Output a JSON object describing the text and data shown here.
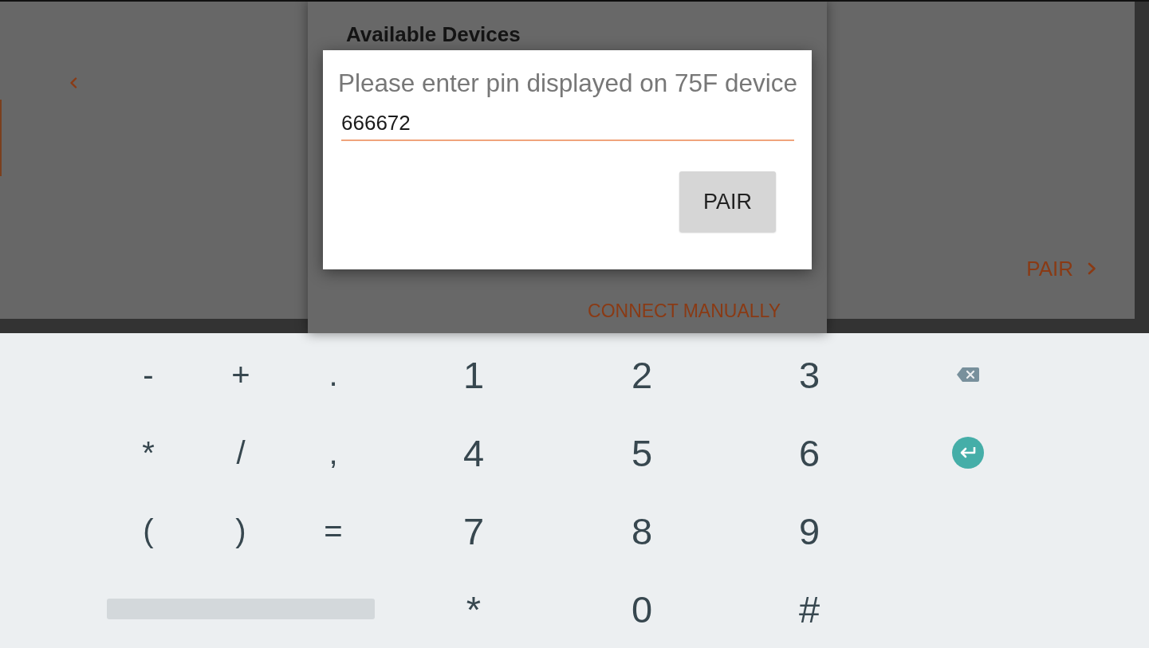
{
  "background": {
    "device_list": {
      "title": "Available Devices",
      "connect_manually": "CONNECT MANUALLY"
    },
    "right_panel": {
      "pair_link": "PAIR"
    }
  },
  "dialog": {
    "message": "Please enter pin displayed on 75F device",
    "pin_value": "666672",
    "button": "PAIR"
  },
  "keyboard": {
    "rows": [
      [
        {
          "kind": "symbol",
          "label": "-"
        },
        {
          "kind": "symbol",
          "label": "+"
        },
        {
          "kind": "symbol",
          "label": "."
        },
        {
          "kind": "digit",
          "label": "1"
        },
        {
          "kind": "digit",
          "label": "2"
        },
        {
          "kind": "digit",
          "label": "3"
        },
        {
          "kind": "backspace"
        }
      ],
      [
        {
          "kind": "symbol",
          "label": "*"
        },
        {
          "kind": "symbol",
          "label": "/"
        },
        {
          "kind": "symbol",
          "label": ","
        },
        {
          "kind": "digit",
          "label": "4"
        },
        {
          "kind": "digit",
          "label": "5"
        },
        {
          "kind": "digit",
          "label": "6"
        },
        {
          "kind": "enter"
        }
      ],
      [
        {
          "kind": "symbol",
          "label": "("
        },
        {
          "kind": "symbol",
          "label": ")"
        },
        {
          "kind": "symbol",
          "label": "="
        },
        {
          "kind": "digit",
          "label": "7"
        },
        {
          "kind": "digit",
          "label": "8"
        },
        {
          "kind": "digit",
          "label": "9"
        }
      ],
      [
        {
          "kind": "space"
        },
        "",
        "",
        {
          "kind": "digit",
          "label": "*"
        },
        {
          "kind": "digit",
          "label": "0"
        },
        {
          "kind": "digit",
          "label": "#"
        }
      ]
    ]
  }
}
